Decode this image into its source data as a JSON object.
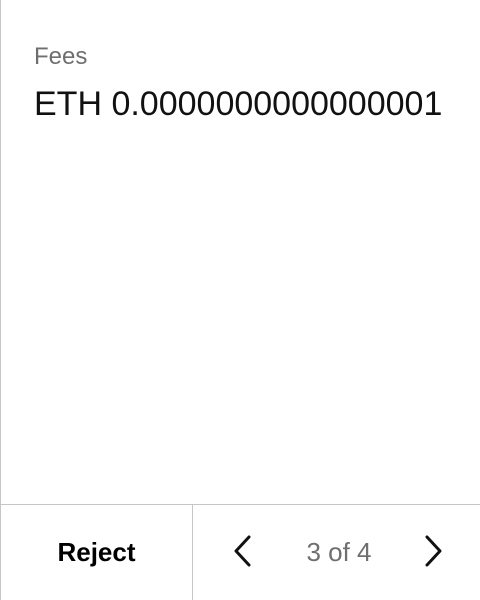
{
  "transaction": {
    "fees_label": "Fees",
    "fees_value": "ETH 0.0000000000000001"
  },
  "footer": {
    "reject_label": "Reject",
    "pager": {
      "indicator": "3 of 4",
      "prev_icon": "chevron-left-icon",
      "next_icon": "chevron-right-icon"
    }
  }
}
